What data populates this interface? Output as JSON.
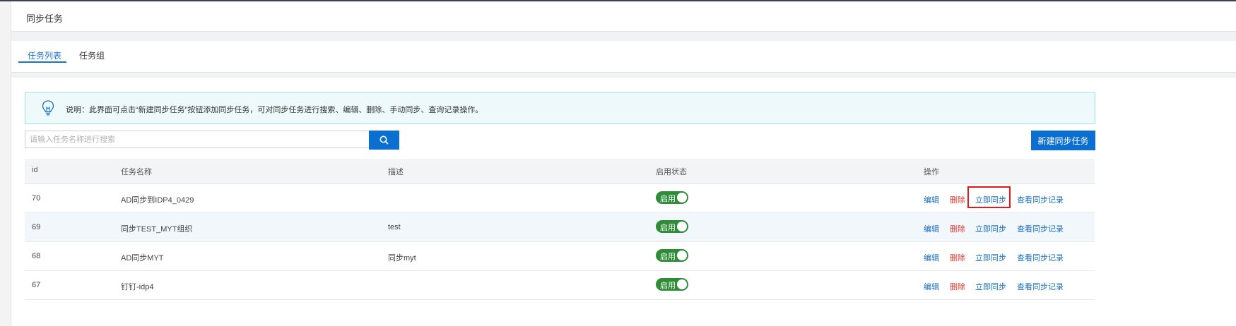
{
  "page": {
    "title": "同步任务"
  },
  "tabs": [
    {
      "label": "任务列表",
      "active": true
    },
    {
      "label": "任务组",
      "active": false
    }
  ],
  "notice": {
    "icon": "lightbulb-icon",
    "text": "说明：此界面可点击“新建同步任务”按钮添加同步任务，可对同步任务进行搜索、编辑、删除、手动同步、查询记录操作。"
  },
  "search": {
    "placeholder": "请输入任务名称进行搜索",
    "value": "",
    "button_icon": "search-icon"
  },
  "actions": {
    "create_label": "新建同步任务"
  },
  "table": {
    "headers": {
      "id": "id",
      "name": "任务名称",
      "desc": "描述",
      "status": "启用状态",
      "ops": "操作"
    },
    "rows": [
      {
        "id": "70",
        "name": "AD同步到IDP4_0429",
        "desc": "",
        "status": "启用"
      },
      {
        "id": "69",
        "name": "同步TEST_MYT组织",
        "desc": "test",
        "status": "启用"
      },
      {
        "id": "68",
        "name": "AD同步MYT",
        "desc": "同步myt",
        "status": "启用"
      },
      {
        "id": "67",
        "name": "钉钉-idp4",
        "desc": "",
        "status": "启用"
      }
    ],
    "ops": {
      "edit": "编辑",
      "delete": "删除",
      "sync_now": "立即同步",
      "view_log": "查看同步记录"
    }
  },
  "colors": {
    "primary": "#0b6fd1",
    "toggle_on": "#2e8b37",
    "danger": "#e0392f",
    "highlight": "#e01b1b"
  }
}
